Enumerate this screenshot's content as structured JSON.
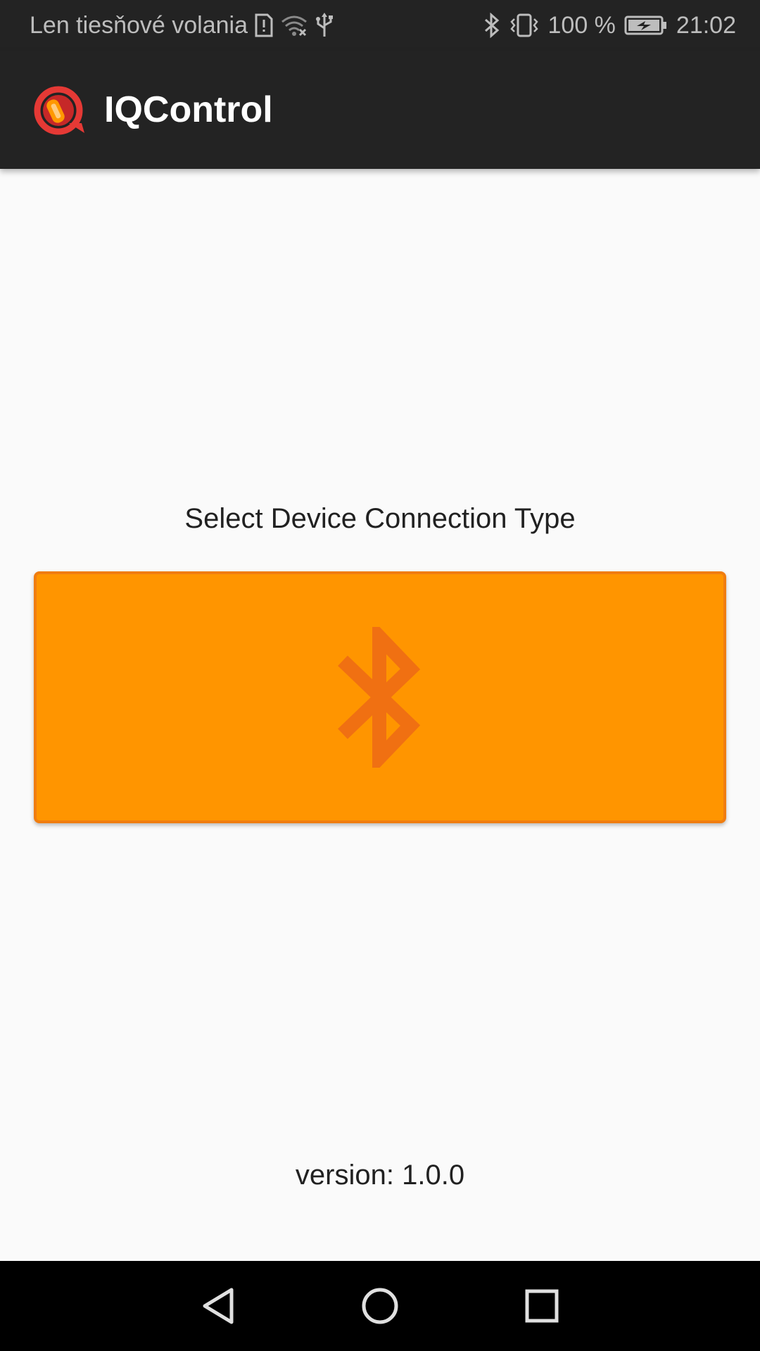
{
  "status_bar": {
    "carrier": "Len tiesňové volania",
    "battery_percent": "100 %",
    "time": "21:02",
    "icons": [
      "sim-alert-icon",
      "wifi-off-icon",
      "usb-icon",
      "bluetooth-icon",
      "vibrate-icon",
      "battery-charging-icon"
    ]
  },
  "app_bar": {
    "title": "IQControl",
    "logo_icon": "iqcontrol-logo-icon"
  },
  "main": {
    "prompt": "Select Device Connection Type",
    "connection_button_icon": "bluetooth-icon",
    "version": "version: 1.0.0"
  },
  "nav_bar": {
    "buttons": [
      "back-icon",
      "home-icon",
      "recents-icon"
    ]
  },
  "colors": {
    "accent": "#ff9500",
    "accent_border": "#f07d10",
    "bluetooth_glyph": "#f07012",
    "bar_background": "#232323"
  }
}
